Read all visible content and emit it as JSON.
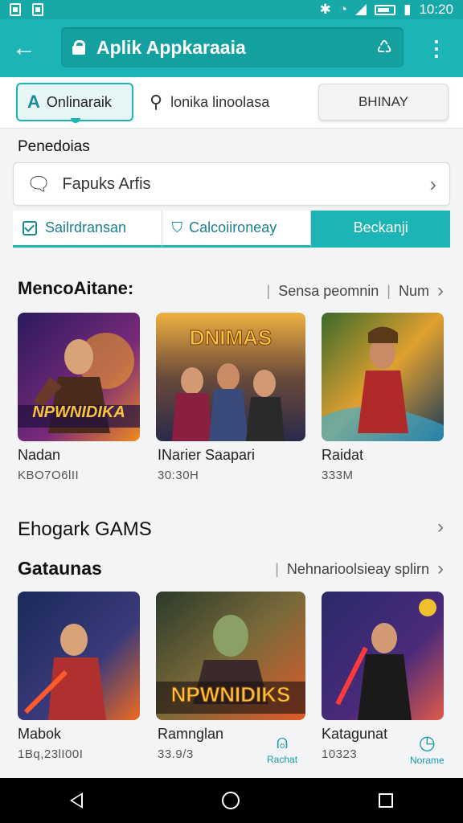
{
  "status_bar": {
    "time": "10:20"
  },
  "app_bar": {
    "title": "Aplik Appkaraaia"
  },
  "tabs": {
    "active_label": "Onlinaraik",
    "search_label": "lonika linoolasa",
    "button_label": "BHINAY"
  },
  "preferences": {
    "label": "Penedoias",
    "search_value": "Fapuks Arfis"
  },
  "segments": [
    {
      "label": "Sailrdransan"
    },
    {
      "label": "Calcoiironeay"
    },
    {
      "label": "Beckanji"
    }
  ],
  "section1": {
    "title": "MencoAitane:",
    "right_text": "Sensa peomnin",
    "right_more": "Num",
    "cards": [
      {
        "title": "Nadan",
        "sub": "KBO7O6lII",
        "badge": "NPWNIDIKA"
      },
      {
        "title": "INarier Saapari",
        "sub": "30:30H",
        "badge": "DNIMAS"
      },
      {
        "title": "Raidat",
        "sub": "333M",
        "badge": ""
      }
    ]
  },
  "section2": {
    "title": "Ehogark GAMS"
  },
  "section3": {
    "title": "Gataunas",
    "right_text": "Nehnarioolsieay splirn",
    "cards": [
      {
        "title": "Mabok",
        "sub": "1Bq,23lI00I",
        "badge": ""
      },
      {
        "title": "Ramnglan",
        "sub": "33.9/3",
        "badge": "NPWNIDIKS"
      },
      {
        "title": "Katagunat",
        "sub": "10323",
        "badge": ""
      }
    ]
  },
  "fabs": [
    {
      "label": "Rachat",
      "icon": "bell-icon"
    },
    {
      "label": "Norame",
      "icon": "clock-icon"
    }
  ],
  "colors": {
    "accent": "#1cb4b4",
    "accent_dark": "#15a0a0"
  }
}
